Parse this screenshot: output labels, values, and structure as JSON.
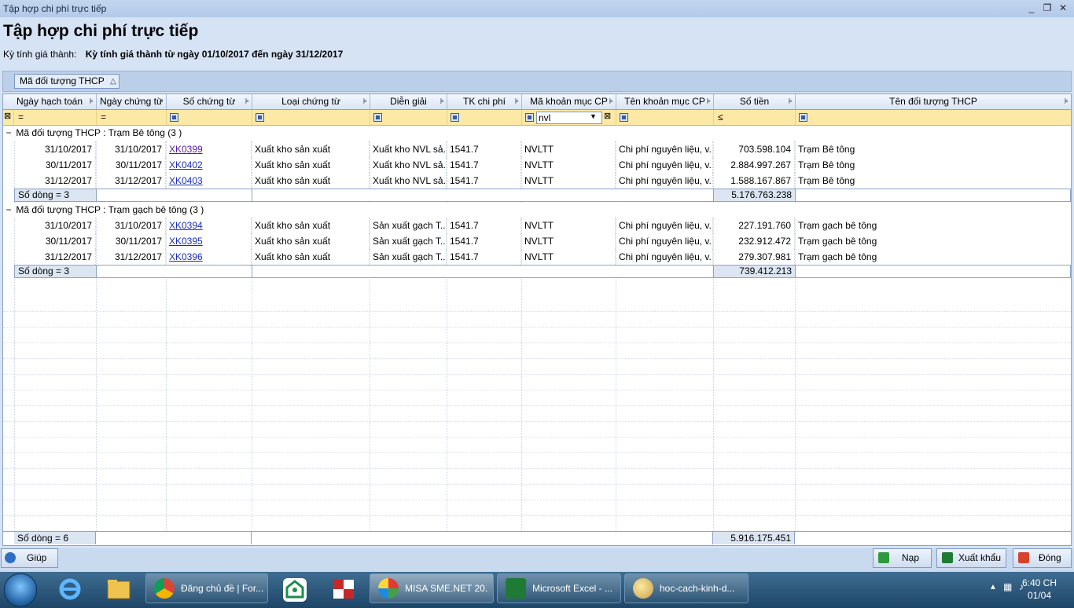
{
  "window": {
    "title": "Tập hợp chi phí trực tiếp",
    "controls": [
      "_",
      "❐",
      "✕"
    ]
  },
  "heading": "Tập hợp chi phí trực tiếp",
  "period": {
    "label": "Kỳ tính giá thành:",
    "value": "Kỳ tính giá thành từ ngày 01/10/2017 đến ngày 31/12/2017"
  },
  "group_by": {
    "label": "Mã đối tượng THCP",
    "sort_icon": "sort-asc-icon"
  },
  "columns": [
    "Ngày hạch toán",
    "Ngày chứng từ",
    "Số chứng từ",
    "Loại chứng từ",
    "Diễn giải",
    "TK chi phí",
    "Mã khoản mục CP",
    "Tên khoản mục CP",
    "Số tiền",
    "Tên đối tượng THCP"
  ],
  "filters": {
    "eq1": "=",
    "eq2": "=",
    "ma_khoan_muc": "nvl",
    "so_tien_op": "≤"
  },
  "groups": [
    {
      "label": "Mã đối tượng THCP : Trạm Bê tông (3 )",
      "toggle": "−",
      "rows": [
        [
          "31/10/2017",
          "31/10/2017",
          "XK0399",
          "Xuất kho sản xuất",
          "Xuất kho NVL sả...",
          "1541.7",
          "NVLTT",
          "Chi phí nguyên liệu, v...",
          "703.598.104",
          "Trạm Bê tông"
        ],
        [
          "30/11/2017",
          "30/11/2017",
          "XK0402",
          "Xuất kho sản xuất",
          "Xuất kho NVL sả...",
          "1541.7",
          "NVLTT",
          "Chi phí nguyên liệu, v...",
          "2.884.997.267",
          "Trạm Bê tông"
        ],
        [
          "31/12/2017",
          "31/12/2017",
          "XK0403",
          "Xuất kho sản xuất",
          "Xuất kho NVL sả...",
          "1541.7",
          "NVLTT",
          "Chi phí nguyên liệu, v...",
          "1.588.167.867",
          "Trạm Bê tông"
        ]
      ],
      "count_label": "Số dòng = 3",
      "total": "5.176.763.238"
    },
    {
      "label": "Mã đối tượng THCP : Trạm gạch bê tông (3 )",
      "toggle": "−",
      "rows": [
        [
          "31/10/2017",
          "31/10/2017",
          "XK0394",
          "Xuất kho sản xuất",
          "Sản xuất gạch T...",
          "1541.7",
          "NVLTT",
          "Chi phí nguyên liệu, v...",
          "227.191.760",
          "Trạm gạch bê tông"
        ],
        [
          "30/11/2017",
          "30/11/2017",
          "XK0395",
          "Xuất kho sản xuất",
          "Sản xuất gạch T...",
          "1541.7",
          "NVLTT",
          "Chi phí nguyên liệu, v...",
          "232.912.472",
          "Trạm gạch bê tông"
        ],
        [
          "31/12/2017",
          "31/12/2017",
          "XK0396",
          "Xuất kho sản xuất",
          "Sản xuất gạch T...",
          "1541.7",
          "NVLTT",
          "Chi phí nguyên liệu, v...",
          "279.307.981",
          "Trạm gạch bê tông"
        ]
      ],
      "count_label": "Số dòng = 3",
      "total": "739.412.213"
    }
  ],
  "footer": {
    "count_label": "Số dòng = 6",
    "total": "5.916.175.451"
  },
  "buttons": {
    "help": "Giúp",
    "reload": "Nạp",
    "export": "Xuất khẩu",
    "close": "Đóng"
  },
  "taskbar": {
    "items": [
      "Đăng chủ đề | For...",
      "MISA SME.NET 20...",
      "Microsoft Excel - ...",
      "hoc-cach-kinh-d..."
    ],
    "time": "6:40 CH",
    "date": "01/04"
  },
  "colors": {
    "filter_row": "#fde9a6",
    "link": "#1a2fb8",
    "visited_link": "#5a1a9a",
    "window_bg": "#d5e3f5"
  }
}
